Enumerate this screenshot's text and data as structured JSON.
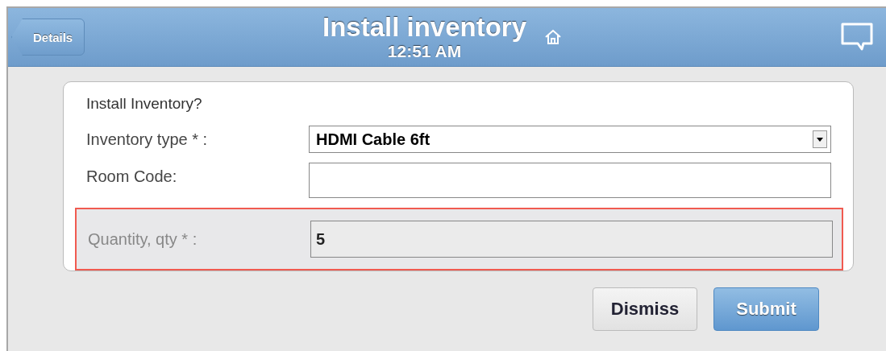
{
  "header": {
    "back_button": "Details",
    "title": "Install inventory",
    "time": "12:51 AM"
  },
  "form": {
    "question": "Install Inventory?",
    "fields": [
      {
        "kind": "select",
        "label": "Inventory type * :",
        "value": "HDMI Cable 6ft",
        "highlighted": false,
        "disabled": false
      },
      {
        "kind": "text",
        "label": "Room Code:",
        "highlighted": false,
        "disabled": false
      },
      {
        "kind": "text",
        "label": "Quantity, qty * :",
        "value": "5",
        "highlighted": true,
        "disabled": true
      }
    ]
  },
  "buttons": [
    {
      "label": "Dismiss",
      "kind": "secondary"
    },
    {
      "label": "Submit",
      "kind": "primary"
    }
  ]
}
